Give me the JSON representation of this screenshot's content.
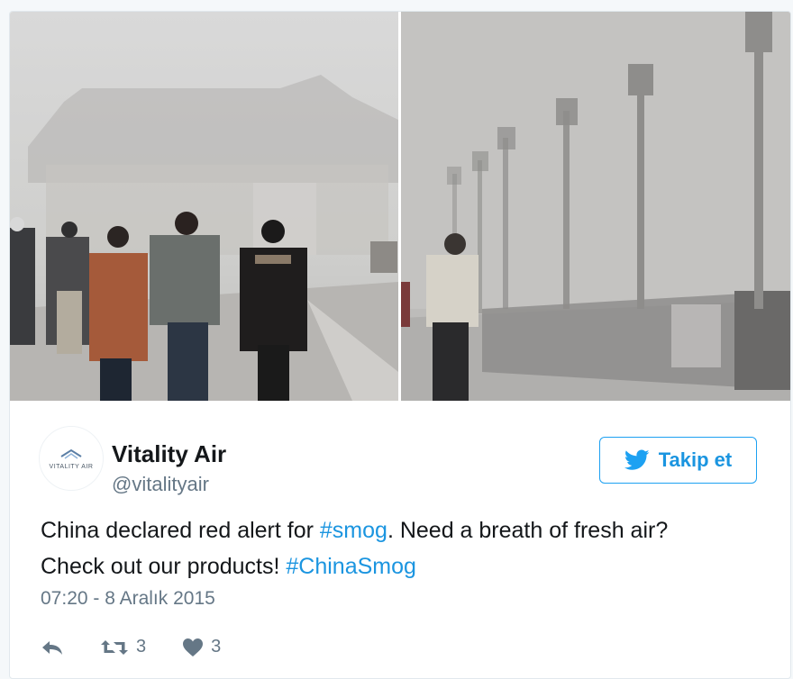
{
  "user": {
    "name": "Vitality Air",
    "handle": "@vitalityair",
    "avatar_text": "VITALITY AIR"
  },
  "follow_button": {
    "label": "Takip et",
    "icon": "twitter-bird-icon"
  },
  "tweet": {
    "text_part1": "China declared red alert for ",
    "hashtag1": "#smog",
    "text_part2": ". Need a breath of fresh air?",
    "text_part3": "Check out our products! ",
    "hashtag2": "#ChinaSmog",
    "timestamp": "07:20 - 8 Aralık 2015"
  },
  "actions": {
    "reply_icon": "reply-icon",
    "retweet_icon": "retweet-icon",
    "retweet_count": "3",
    "like_icon": "heart-icon",
    "like_count": "3"
  },
  "media": [
    {
      "description_icon": "photo-icon"
    },
    {
      "description_icon": "photo-icon"
    }
  ],
  "colors": {
    "accent": "#1da1f2",
    "link": "#1b95e0",
    "secondary_text": "#657786",
    "primary_text": "#14171a"
  }
}
